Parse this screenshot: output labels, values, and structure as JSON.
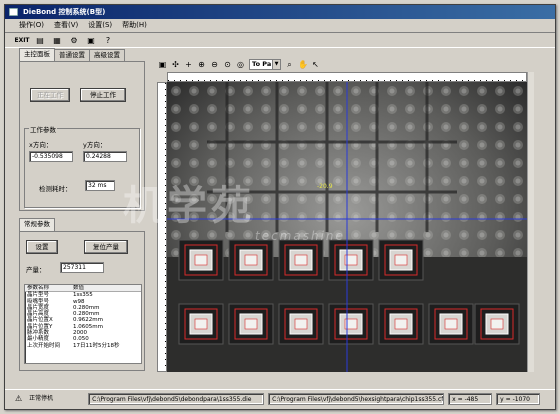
{
  "app": {
    "title": "DieBond 控制系统(B型)"
  },
  "menu": [
    "操作(O)",
    "查看(V)",
    "设置(S)",
    "帮助(H)"
  ],
  "toolbar": {
    "exit_label": "EXIT"
  },
  "tabs": [
    "主控面板",
    "普通设置",
    "高级设置"
  ],
  "control": {
    "start_button": "正在工作",
    "stop_button": "停止工作",
    "group_work_params": "工作参数",
    "x_label": "x方向：",
    "y_label": "y方向：",
    "x_value": "-0.535098",
    "y_value": "0.24288",
    "detect_time_label": "检测耗时：",
    "detect_time_value": "32 ms"
  },
  "common_tab": "常规参数",
  "common": {
    "settings_button": "设置",
    "reset_button": "复位产量",
    "output_label": "产量：",
    "output_value": "257311"
  },
  "param_table": {
    "headers": [
      "参数名称",
      "数值"
    ],
    "rows": [
      [
        "晶片型号",
        "1ss355"
      ],
      [
        "吸嘴型号",
        "w98"
      ],
      [
        "晶片宽度",
        "0.280mm"
      ],
      [
        "晶片高度",
        "0.280mm"
      ],
      [
        "晶片位置X",
        "0.9622mm"
      ],
      [
        "晶片位置Y",
        "1.0605mm"
      ],
      [
        "脉冲系数",
        "2000"
      ],
      [
        "最小精度",
        "0.050"
      ],
      [
        "上次开始时间",
        "17日11时5分18秒"
      ]
    ]
  },
  "image_toolbar": {
    "zoom_value": "To Pa"
  },
  "view": {
    "center_label": "-20.9"
  },
  "status": {
    "state": "正常停机",
    "path1": "C:\\Program Files\\vfj\\debond5\\debondpara\\1ss355.die",
    "path2": "C:\\Program Files\\vfj\\debond5\\hexsightpara\\chip1ss355.cfg",
    "x_coord": "x = -485",
    "y_coord": "y = -1070"
  },
  "watermark": {
    "main": "机学苑",
    "sub": "tecmashine"
  },
  "colors": {
    "title_start": "#0a246a",
    "title_end": "#3a6ea5",
    "crosshair": "#2a3ad8",
    "chip_outline": "#d82a2a"
  }
}
